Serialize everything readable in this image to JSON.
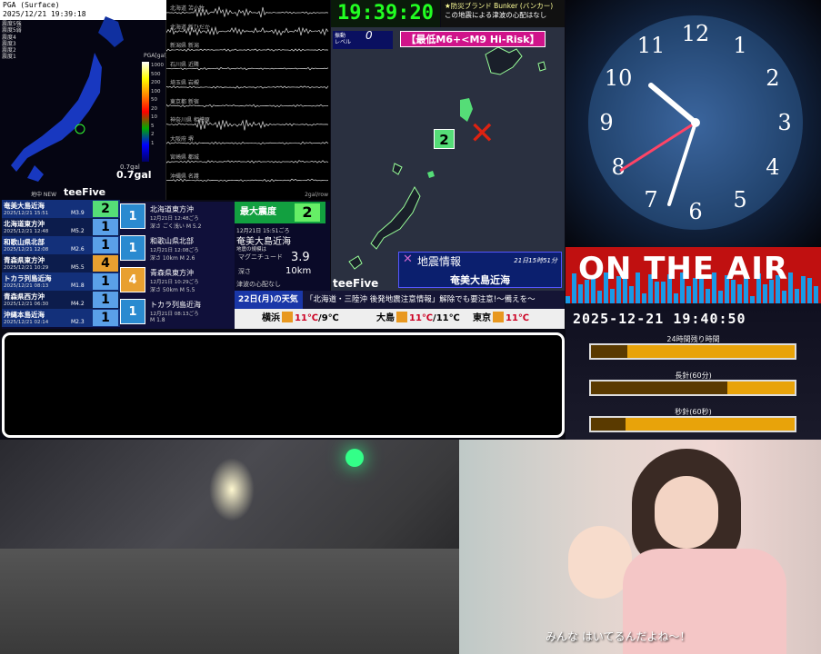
{
  "pga": {
    "title": "PGA (Surface)",
    "datetime": "2025/12/21 19:39:18",
    "stations": [
      "震度5強",
      "震度5弱",
      "震度4",
      "震度3",
      "震度2",
      "震度1"
    ],
    "legend_title": "PGA[gal]",
    "ticks": [
      "1000",
      "500",
      "200",
      "100",
      "50",
      "20",
      "10",
      "5",
      "2",
      "1"
    ],
    "value": "0.7gal",
    "value_small": "0.7gal",
    "footer_note": "地中 NEW",
    "brand": "teeFive"
  },
  "waveforms": {
    "stations": [
      "北海道 苫小牧",
      "北海道 新ひだか",
      "新潟県 新潟",
      "石川県 近隣",
      "埼玉県 岩槻",
      "東京都 新宿",
      "神奈川県 相模原",
      "大阪府 堺",
      "宮崎県 都城",
      "沖縄県 名護"
    ],
    "footer": "2gal/row"
  },
  "clock_digital": "19:39:20",
  "bunker": {
    "title": "★防災ブランド Bunker (バンカー)",
    "text": "この地震による津波の心配はなし"
  },
  "map": {
    "level_label": "振動\nレベル",
    "level_value": "0",
    "risk": "【最低M6+<M9 Hi-Risk】",
    "intensity": "2",
    "epicenter": "✕",
    "brand": "teeFive",
    "info_title": "地震情報",
    "info_date": "21日15時51分",
    "info_region": "奄美大島近海"
  },
  "quakes": [
    {
      "name": "奄美大島近海",
      "date": "2025/12/21 15:51",
      "mag": "M3.9",
      "int": "2",
      "bg": "#55dd77"
    },
    {
      "name": "北海道東方沖",
      "date": "2025/12/21 12:48",
      "mag": "M5.2",
      "int": "1",
      "bg": "#5aa0e8"
    },
    {
      "name": "和歌山県北部",
      "date": "2025/12/21 12:08",
      "mag": "M2.6",
      "int": "1",
      "bg": "#5aa0e8"
    },
    {
      "name": "青森県東方沖",
      "date": "2025/12/21 10:29",
      "mag": "M5.5",
      "int": "4",
      "bg": "#e8a030"
    },
    {
      "name": "トカラ列島近海",
      "date": "2025/12/21 08:13",
      "mag": "M1.8",
      "int": "1",
      "bg": "#5aa0e8"
    },
    {
      "name": "青森県西方沖",
      "date": "2025/12/21 06:30",
      "mag": "M4.2",
      "int": "1",
      "bg": "#5aa0e8"
    },
    {
      "name": "沖縄本島近海",
      "date": "2025/12/21 02:14",
      "mag": "M2.3",
      "int": "1",
      "bg": "#5aa0e8"
    }
  ],
  "list_header": "地震情報",
  "details": [
    {
      "int": "1",
      "name": "北海道東方沖",
      "date": "12月21日 12:48ごろ",
      "meta": "深さ ごく浅い  M 5.2"
    },
    {
      "int": "1",
      "name": "和歌山県北部",
      "date": "12月21日 12:08ごろ",
      "meta": "深さ 10km  M 2.6"
    },
    {
      "int": "4",
      "name": "青森県東方沖",
      "date": "12月21日 10:29ごろ",
      "meta": "深さ 50km  M 5.5"
    },
    {
      "int": "1",
      "name": "トカラ列島近海",
      "date": "12月21日 08:13ごろ",
      "meta": "M 1.8"
    }
  ],
  "maxint": {
    "label": "最大震度",
    "value": "2",
    "date": "12月21日 15:51ごろ",
    "region": "奄美大島近海",
    "sub": "地震の規模は",
    "mag_label": "マグニチュード",
    "mag_value": "3.9",
    "depth_label": "深さ",
    "depth_value": "10km",
    "tsunami": "津波の心配なし"
  },
  "weather": {
    "date": "22日(月)の天気",
    "news": "「北海道・三陸沖 後発地震注意情報」解除でも要注意!～備えを～",
    "cities": [
      {
        "name": "横浜",
        "hi": "11℃",
        "lo": "9℃"
      },
      {
        "name": "大島",
        "hi": "11℃",
        "lo": "11℃"
      },
      {
        "name": "東京",
        "hi": "11℃",
        "lo": ""
      }
    ]
  },
  "on_air": "ON THE AIR",
  "datetime": "2025-12-21 19:40:50",
  "progress": [
    {
      "label": "24時間残り時間",
      "fraction": 0.18
    },
    {
      "label": "長針(60分)",
      "fraction": 0.67
    },
    {
      "label": "秒針(60秒)",
      "fraction": 0.17
    }
  ],
  "subtitle": "みんな はいてるんだよね～！",
  "colors": {
    "accent": "#d0138a",
    "air": "#c01010",
    "digital": "#22ff22"
  }
}
